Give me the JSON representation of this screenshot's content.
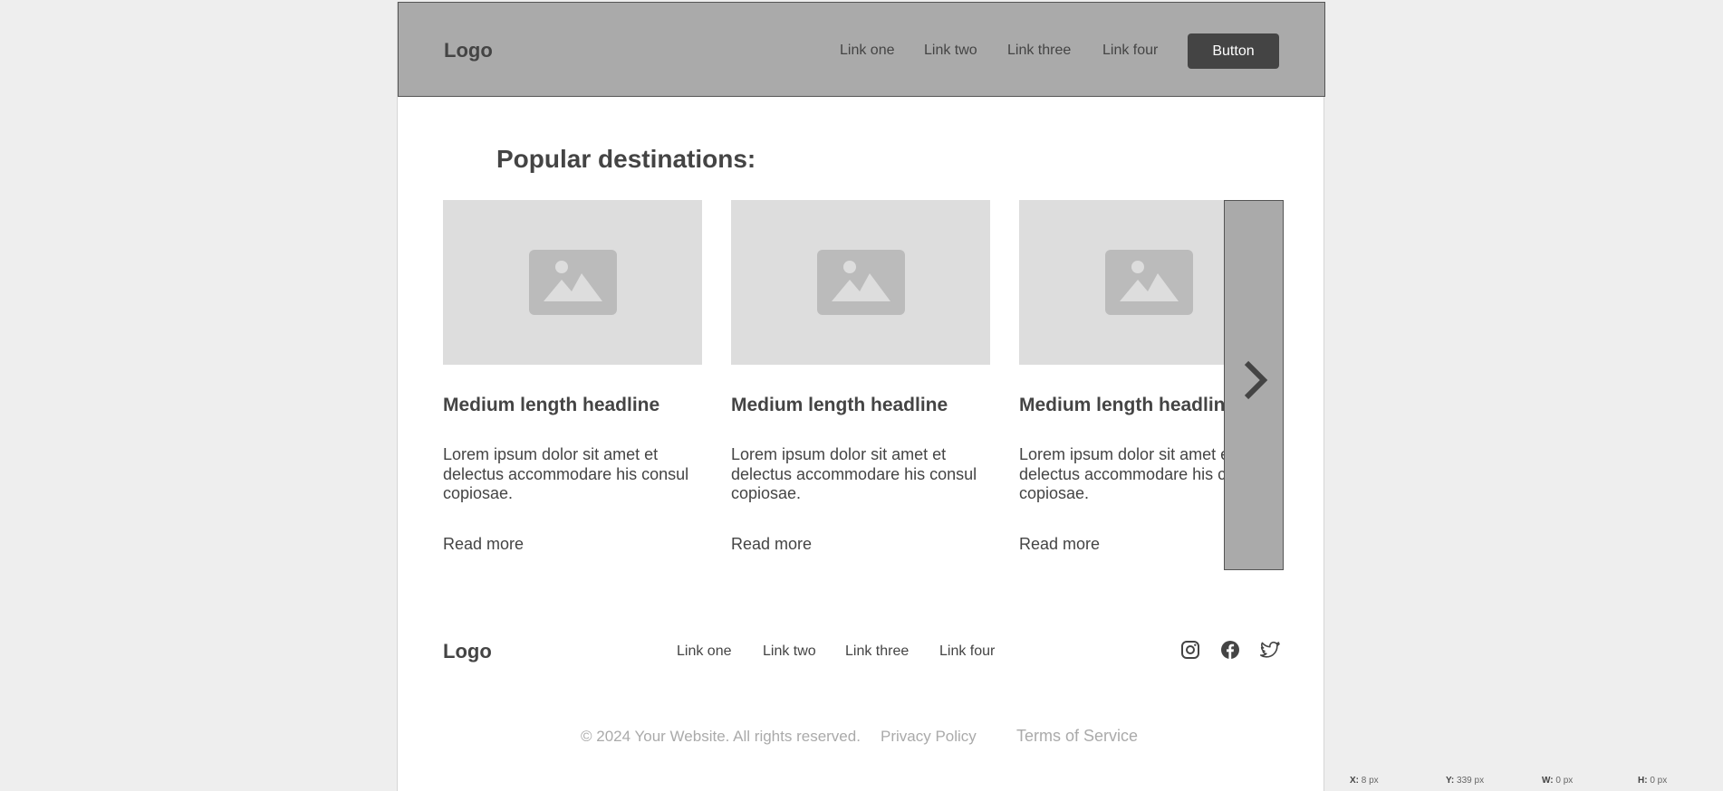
{
  "header": {
    "logo": "Logo",
    "links": [
      "Link one",
      "Link two",
      "Link three",
      "Link four"
    ],
    "button": "Button"
  },
  "main": {
    "title": "Popular destinations:",
    "cards": [
      {
        "headline": "Medium length headline",
        "body": "Lorem ipsum dolor sit amet et delectus accommodare his consul copiosae.",
        "link": "Read more"
      },
      {
        "headline": "Medium length headline",
        "body": "Lorem ipsum dolor sit amet et delectus accommodare his consul copiosae.",
        "link": "Read more"
      },
      {
        "headline": "Medium length headline",
        "body": "Lorem ipsum dolor sit amet et delectus accommodare his consul copiosae.",
        "link": "Read more"
      }
    ],
    "carousel_next_icon": "chevron-right-icon"
  },
  "footer": {
    "logo": "Logo",
    "links": [
      "Link one",
      "Link two",
      "Link three",
      "Link four"
    ],
    "social": [
      "instagram-icon",
      "facebook-icon",
      "twitter-icon"
    ],
    "copyright": "© 2024 Your Website. All rights reserved.",
    "privacy": "Privacy Policy",
    "terms": "Terms of Service"
  },
  "status_bar": {
    "x_label": "X:",
    "x_value": "8 px",
    "y_label": "Y:",
    "y_value": "339 px",
    "w_label": "W:",
    "w_value": "0 px",
    "h_label": "H:",
    "h_value": "0 px"
  },
  "colors": {
    "page_bg": "#eeeeee",
    "header_bg": "#aaaaaa",
    "button_bg": "#444444",
    "image_placeholder": "#dddddd",
    "text": "#444444",
    "muted_text": "#aaaaaa"
  }
}
